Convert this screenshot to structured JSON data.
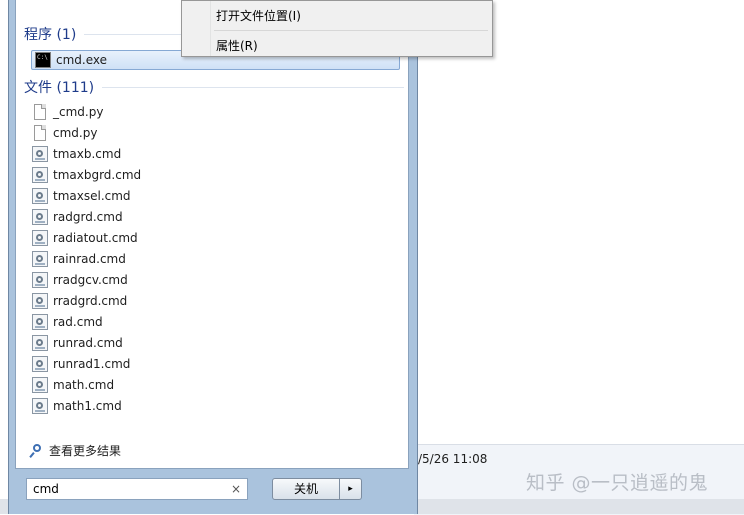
{
  "background": {
    "status_date": "/5/26 11:08",
    "watermark": "知乎 @一只逍遥的鬼"
  },
  "start_menu": {
    "programs_header": "程序 (1)",
    "programs": [
      {
        "label": "cmd.exe",
        "icon": "cmd-console-icon",
        "selected": true
      }
    ],
    "files_header": "文件 (111)",
    "files": [
      {
        "label": "_cmd.py",
        "icon": "document-icon"
      },
      {
        "label": "cmd.py",
        "icon": "document-icon"
      },
      {
        "label": "tmaxb.cmd",
        "icon": "batch-file-icon"
      },
      {
        "label": "tmaxbgrd.cmd",
        "icon": "batch-file-icon"
      },
      {
        "label": "tmaxsel.cmd",
        "icon": "batch-file-icon"
      },
      {
        "label": "radgrd.cmd",
        "icon": "batch-file-icon"
      },
      {
        "label": "radiatout.cmd",
        "icon": "batch-file-icon"
      },
      {
        "label": "rainrad.cmd",
        "icon": "batch-file-icon"
      },
      {
        "label": "rradgcv.cmd",
        "icon": "batch-file-icon"
      },
      {
        "label": "rradgrd.cmd",
        "icon": "batch-file-icon"
      },
      {
        "label": "rad.cmd",
        "icon": "batch-file-icon"
      },
      {
        "label": "runrad.cmd",
        "icon": "batch-file-icon"
      },
      {
        "label": "runrad1.cmd",
        "icon": "batch-file-icon"
      },
      {
        "label": "math.cmd",
        "icon": "batch-file-icon"
      },
      {
        "label": "math1.cmd",
        "icon": "batch-file-icon"
      }
    ],
    "see_more": "查看更多结果",
    "search_value": "cmd",
    "clear_glyph": "×",
    "shutdown_label": "关机",
    "shutdown_arrow": "▸"
  },
  "context_menu": {
    "items": [
      "打开文件位置(I)",
      "属性(R)"
    ]
  }
}
